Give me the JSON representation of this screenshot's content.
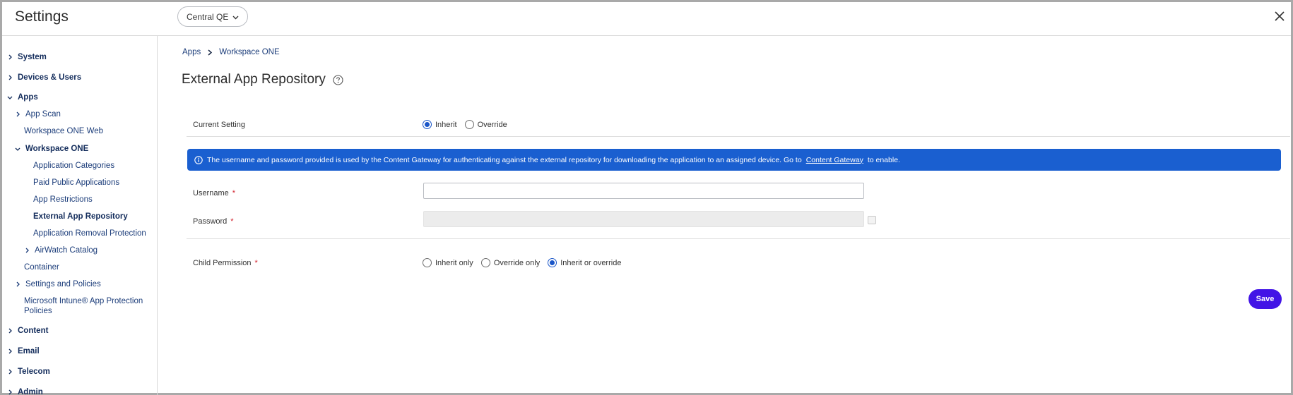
{
  "header": {
    "app_title": "Settings",
    "org_picker_label": "Central QE"
  },
  "sidebar": {
    "system": "System",
    "devices_users": "Devices & Users",
    "apps": "Apps",
    "app_scan": "App Scan",
    "workspace_one_web": "Workspace ONE Web",
    "workspace_one": "Workspace ONE",
    "application_categories": "Application Categories",
    "paid_public_applications": "Paid Public Applications",
    "app_restrictions": "App Restrictions",
    "external_app_repository": "External App Repository",
    "application_removal_protection": "Application Removal Protection",
    "airwatch_catalog": "AirWatch Catalog",
    "container": "Container",
    "settings_and_policies": "Settings and Policies",
    "microsoft_intune": "Microsoft Intune® App Protection Policies",
    "content": "Content",
    "email": "Email",
    "telecom": "Telecom",
    "admin": "Admin"
  },
  "breadcrumb": {
    "apps": "Apps",
    "workspace_one": "Workspace ONE"
  },
  "page": {
    "title": "External App Repository"
  },
  "form": {
    "current_setting_label": "Current Setting",
    "current_setting_options": {
      "inherit": "Inherit",
      "override": "Override"
    },
    "current_setting_selected": "Inherit",
    "banner_text": "The username and password provided is used by the Content Gateway for authenticating against the external repository for downloading the application to an assigned device. Go to",
    "banner_link": "Content Gateway",
    "banner_suffix": "to enable.",
    "username_label": "Username",
    "username_value": "",
    "password_label": "Password",
    "password_value": "",
    "required_mark": "*",
    "child_permission_label": "Child Permission",
    "child_permission_options": {
      "inherit_only": "Inherit only",
      "override_only": "Override only",
      "inherit_or_override": "Inherit or override"
    },
    "child_permission_selected": "Inherit or override",
    "save_label": "Save"
  },
  "colors": {
    "accent": "#1a5fd0",
    "save_button": "#4214e6",
    "required": "#d3232e"
  }
}
